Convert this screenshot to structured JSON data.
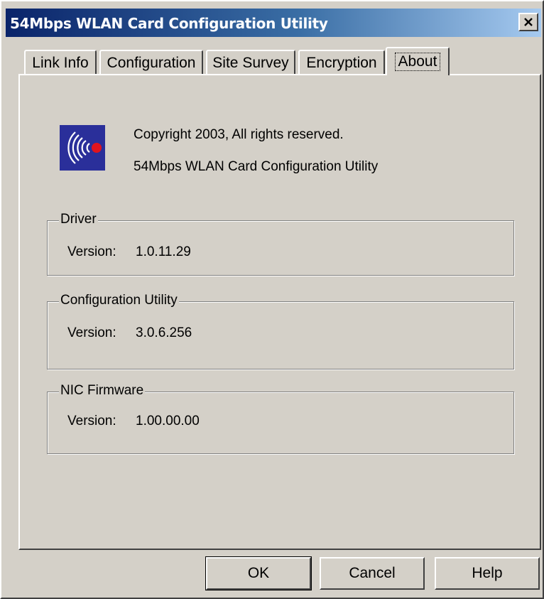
{
  "window": {
    "title": "54Mbps WLAN Card Configuration Utility",
    "close_label": "✕"
  },
  "tabs": [
    {
      "label": "Link Info",
      "active": false
    },
    {
      "label": "Configuration",
      "active": false
    },
    {
      "label": "Site Survey",
      "active": false
    },
    {
      "label": "Encryption",
      "active": false
    },
    {
      "label": "About",
      "active": true
    }
  ],
  "about": {
    "logo_icon": "wireless-signal-icon",
    "copyright": "Copyright 2003, All rights reserved.",
    "product_name": "54Mbps WLAN Card Configuration Utility"
  },
  "groups": {
    "driver": {
      "title": "Driver",
      "version_label": "Version:",
      "version": "1.0.11.29"
    },
    "config_utility": {
      "title": "Configuration Utility",
      "version_label": "Version:",
      "version": "3.0.6.256"
    },
    "nic_firmware": {
      "title": "NIC Firmware",
      "version_label": "Version:",
      "version": "1.00.00.00"
    }
  },
  "buttons": {
    "ok": "OK",
    "cancel": "Cancel",
    "help": "Help"
  },
  "colors": {
    "title_bar_start": "#0a246a",
    "title_bar_end": "#a6caf0",
    "face": "#d4d0c8",
    "logo_bg": "#2a2f9a",
    "logo_dot": "#e0141e"
  }
}
